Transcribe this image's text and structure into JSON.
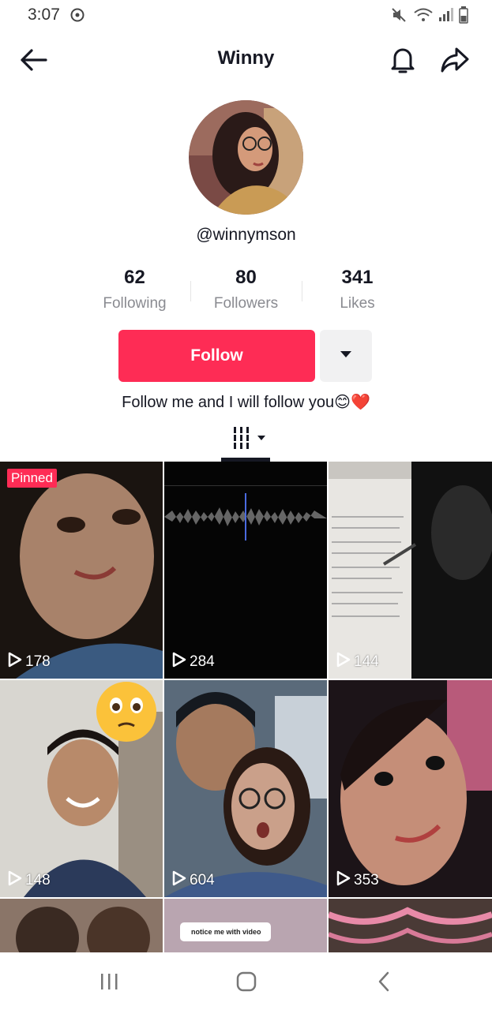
{
  "status": {
    "time": "3:07",
    "icons": [
      "sync-icon",
      "mute-icon",
      "wifi-icon",
      "signal-icon",
      "battery-icon"
    ]
  },
  "header": {
    "title": "Winny",
    "icons": [
      "back-arrow-icon",
      "bell-icon",
      "share-icon"
    ]
  },
  "profile": {
    "username": "@winnymson",
    "stats": [
      {
        "value": "62",
        "label": "Following"
      },
      {
        "value": "80",
        "label": "Followers"
      },
      {
        "value": "341",
        "label": "Likes"
      }
    ],
    "follow_label": "Follow",
    "bio": "Follow me and I will follow you😊❤️"
  },
  "videos": [
    {
      "views": "178",
      "pinned": true,
      "pinned_label": "Pinned"
    },
    {
      "views": "284"
    },
    {
      "views": "144"
    },
    {
      "views": "148"
    },
    {
      "views": "604"
    },
    {
      "views": "353"
    }
  ],
  "partial_row_caption": "notice me with video",
  "colors": {
    "accent": "#fe2c55",
    "text": "#161823",
    "muted": "#8a8b91"
  }
}
